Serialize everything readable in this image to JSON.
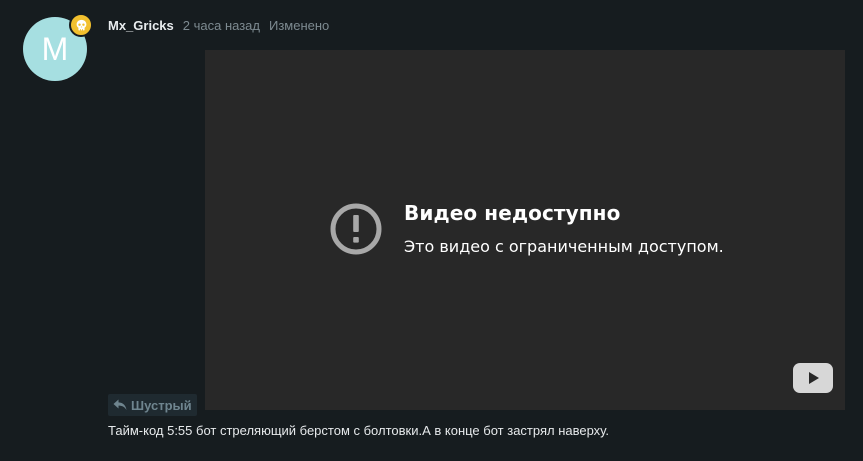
{
  "user": {
    "avatar_letter": "M",
    "name": "Mx_Gricks",
    "time": "2 часа назад",
    "edited": "Изменено"
  },
  "video": {
    "title": "Видео недоступно",
    "subtitle": "Это видео с ограниченным доступом.",
    "icons": [
      "error-circle-icon",
      "youtube-logo-icon"
    ]
  },
  "quote": {
    "label": "Шустрый",
    "icon": "reply-arrow-icon"
  },
  "comment": {
    "text": "Тайм-код 5:55 бот стреляющий берстом с болтовки.А в конце бот застрял наверху."
  },
  "colors": {
    "background": "#161c1f",
    "avatar": "#a6dfe1",
    "badge": "#f2c02e",
    "video_bg": "#282828",
    "muted_text": "#7d8a90"
  }
}
